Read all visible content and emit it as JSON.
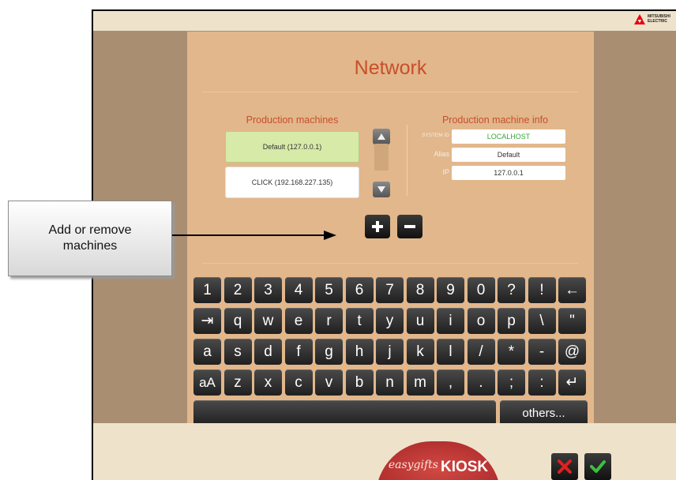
{
  "screen": {
    "title": "Network",
    "brand_lines": [
      "MITSUBISHI",
      "ELECTRIC"
    ]
  },
  "machines": {
    "header": "Production machines",
    "items": [
      {
        "label": "Default (127.0.0.1)",
        "selected": true
      },
      {
        "label": "CLICK (192.168.227.135)",
        "selected": false
      }
    ]
  },
  "info": {
    "header": "Production machine info",
    "system_id_label": "SYSTEM ID",
    "system_id": "LOCALHOST",
    "alias_label": "Alias",
    "alias": "Default",
    "ip_label": "IP",
    "ip": "127.0.0.1"
  },
  "keyboard": {
    "rows": [
      [
        "1",
        "2",
        "3",
        "4",
        "5",
        "6",
        "7",
        "8",
        "9",
        "0",
        "?",
        "!",
        "←"
      ],
      [
        "⇥",
        "q",
        "w",
        "e",
        "r",
        "t",
        "y",
        "u",
        "i",
        "o",
        "p",
        "\\",
        "\""
      ],
      [
        "a",
        "s",
        "d",
        "f",
        "g",
        "h",
        "j",
        "k",
        "l",
        "/",
        "*",
        "-",
        "@"
      ],
      [
        "aA",
        "z",
        "x",
        "c",
        "v",
        "b",
        "n",
        "m",
        ",",
        ".",
        ";",
        ":",
        "↵"
      ]
    ],
    "others_label": "others..."
  },
  "footer": {
    "logo_part1": "easygifts",
    "logo_part2": "KIOSK"
  },
  "callout": {
    "text": "Add or remove machines"
  },
  "colors": {
    "accent": "#c84f2a",
    "selected_bg": "#d7eaa8",
    "panel_bg": "#e2b78c",
    "cancel": "#e02020",
    "confirm": "#3fbf3f"
  }
}
